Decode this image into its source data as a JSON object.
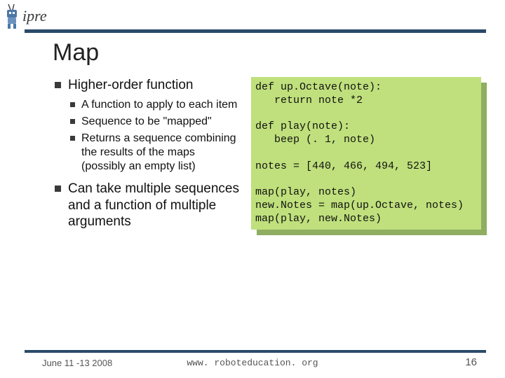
{
  "logo": {
    "text": "ipre"
  },
  "title": "Map",
  "bullets": {
    "b1": "Higher-order function",
    "sub": {
      "s1": "A function to apply to each item",
      "s2": "Sequence to be \"mapped\"",
      "s3": "Returns a sequence combining the results of the maps\n(possibly an empty list)"
    },
    "b2": "Can take multiple sequences and a function of multiple arguments"
  },
  "code": "def up.Octave(note):\n   return note *2\n\ndef play(note):\n   beep (. 1, note)\n\nnotes = [440, 466, 494, 523]\n\nmap(play, notes)\nnew.Notes = map(up.Octave, notes)\nmap(play, new.Notes)",
  "footer": {
    "date": "June 11 -13 2008",
    "url": "www. roboteducation. org",
    "page": "16"
  },
  "colors": {
    "rule": "#2a4a6a",
    "code_bg": "#bfe07c",
    "code_shadow": "#8fae61"
  }
}
